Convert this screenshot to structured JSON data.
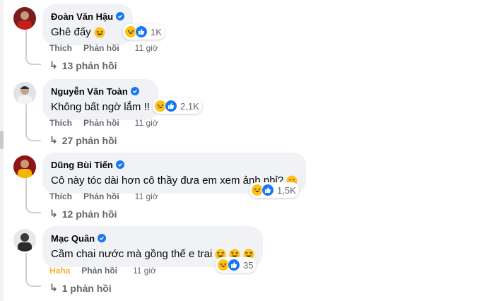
{
  "colors": {
    "bubble_bg": "#f0f2f5",
    "meta_text": "#65676b",
    "verified_blue": "#1877f2",
    "haha_yellow": "#f7b125",
    "like_blue": "#1877f2"
  },
  "comments": [
    {
      "author": "Đoàn Văn Hậu",
      "text": "Ghê đấy",
      "reactions": {
        "icons": [
          "haha-icon",
          "like-icon"
        ],
        "count": "1K"
      },
      "actions": {
        "like": "Thích",
        "reply": "Phản hồi",
        "time": "11 giờ"
      },
      "replies": "13 phản hồi"
    },
    {
      "author": "Nguyễn Văn Toàn",
      "text": "Không bất ngờ lắm !!",
      "reactions": {
        "icons": [
          "haha-icon",
          "like-icon"
        ],
        "count": "2,1K"
      },
      "actions": {
        "like": "Thích",
        "reply": "Phản hồi",
        "time": "11 giờ"
      },
      "replies": "27 phản hồi"
    },
    {
      "author": "Dũng Bùi Tiến",
      "text": "Cô này tóc dài hơn cô thầy đưa em xem ảnh nhỉ?",
      "reactions": {
        "icons": [
          "haha-icon",
          "like-icon"
        ],
        "count": "1,5K"
      },
      "actions": {
        "like": "Thích",
        "reply": "Phản hồi",
        "time": "11 giờ"
      },
      "replies": "12 phản hồi"
    },
    {
      "author": "Mạc Quân",
      "text": "Cầm chai nước mà gồng thế e trai",
      "reactions": {
        "icons": [
          "haha-icon",
          "like-icon"
        ],
        "count": "35"
      },
      "actions": {
        "like": "Haha",
        "reply": "Phản hồi",
        "time": "11 giờ"
      },
      "replies": "1 phản hồi"
    }
  ]
}
